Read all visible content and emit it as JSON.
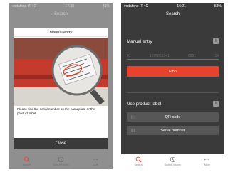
{
  "left": {
    "status": {
      "carrier": "vodafone IT 4G",
      "time": "17:30",
      "battery": "41%"
    },
    "nav_title": "Search",
    "modal": {
      "title": "Manual entry",
      "instruction": "Please find the serial number on the nameplate or the product label.",
      "close_label": "Close"
    },
    "tabs": [
      {
        "label": "Search"
      },
      {
        "label": "Search history"
      },
      {
        "label": "More"
      }
    ]
  },
  "right": {
    "status": {
      "carrier": "vodafone IT 4G",
      "time": "16:21",
      "battery": "53%"
    },
    "nav_title": "Search",
    "manual_entry": {
      "title": "Manual entry",
      "serial_parts": [
        "01",
        "1076053341",
        "0001",
        "14"
      ],
      "find_label": "Find"
    },
    "product_label": {
      "title": "Use product label",
      "qr_label": "QR code",
      "qr_prefix": "[:::]",
      "serial_label": "Serial number",
      "serial_prefix": "[|||]"
    },
    "tabs": [
      {
        "label": "Search"
      },
      {
        "label": "Search history"
      },
      {
        "label": "More"
      }
    ]
  },
  "colors": {
    "accent": "#e8412c",
    "dark_bg": "#3a3a3a",
    "button_grey": "#575757"
  },
  "icons": [
    "search-icon",
    "history-icon",
    "more-icon",
    "info-icon"
  ]
}
